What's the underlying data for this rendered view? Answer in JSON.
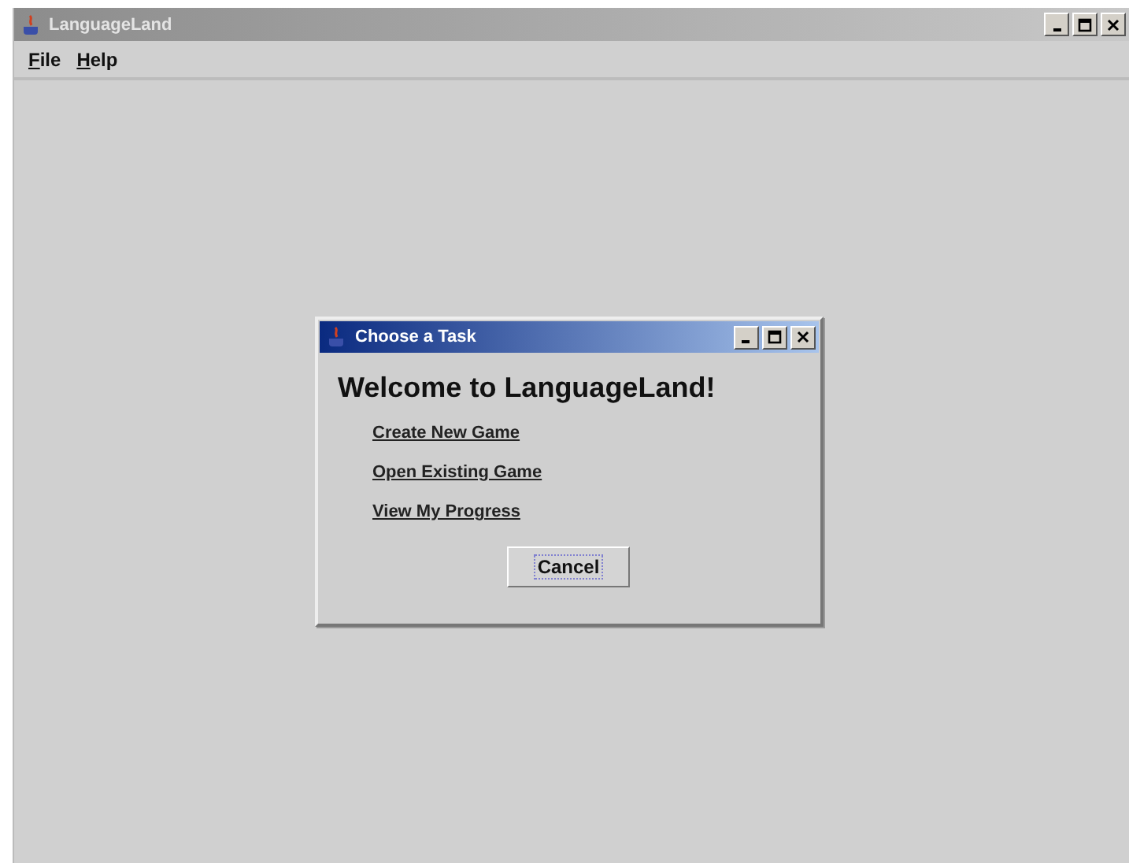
{
  "window": {
    "title": "LanguageLand"
  },
  "menu": [
    {
      "label": "File",
      "mnemonic": true
    },
    {
      "label": "Help",
      "mnemonic": true
    }
  ],
  "dialog": {
    "title": "Choose a Task",
    "heading": "Welcome to LanguageLand!",
    "links": [
      "Create New Game",
      "Open Existing Game",
      "View My Progress"
    ],
    "buttons": [
      {
        "label": "Cancel",
        "focused": true
      }
    ]
  }
}
